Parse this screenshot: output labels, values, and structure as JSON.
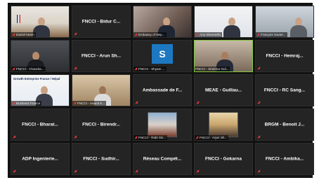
{
  "participants": [
    {
      "name": "Daniel Marin",
      "type": "video"
    },
    {
      "name": "FNCCI - Bidur C...",
      "type": "name"
    },
    {
      "name": "Embassy of Nep...",
      "type": "video"
    },
    {
      "name": "Ana Silvestello",
      "type": "video"
    },
    {
      "name": "François Xavier...",
      "type": "video"
    },
    {
      "name": "FNCCI - Chandra...",
      "type": "video"
    },
    {
      "name": "FNCCI - Arun Sh...",
      "type": "name"
    },
    {
      "name": "FNCCI - Shyam ...",
      "type": "avatar",
      "avatar_letter": "S"
    },
    {
      "name": "FNCCI - Shekhar Gol...",
      "type": "video"
    },
    {
      "name": "FNCCI - Hemraj...",
      "type": "name"
    },
    {
      "name": "Business France",
      "type": "video",
      "poster_text": "Growth Enterprise France / Népal"
    },
    {
      "name": "FNCCI - Anand K...",
      "type": "video"
    },
    {
      "name": "Ambassade de F...",
      "type": "name"
    },
    {
      "name": "MEAE - Guillau...",
      "type": "name"
    },
    {
      "name": "FNCCI - RC Sang...",
      "type": "name"
    },
    {
      "name": "FNCCI - Bharat...",
      "type": "name"
    },
    {
      "name": "FNCCI - Birendr...",
      "type": "name"
    },
    {
      "name": "FNCCI - Rabi Sin...",
      "type": "picture"
    },
    {
      "name": "FNCCI - Arjun Sh...",
      "type": "picture"
    },
    {
      "name": "BRGM - Benoit J...",
      "type": "name"
    },
    {
      "name": "ADP Ingenierie...",
      "type": "name"
    },
    {
      "name": "FNCCI - Sudhir...",
      "type": "name"
    },
    {
      "name": "Réseau Compét...",
      "type": "name"
    },
    {
      "name": "FNCCI - Gokarna",
      "type": "name"
    },
    {
      "name": "FNCCI - Ambika...",
      "type": "name"
    }
  ],
  "colors": {
    "background": "#121212",
    "tile": "#242424",
    "active_border": "#7ecb3a",
    "mute": "#e23a3a",
    "avatar": "#1d78c1"
  }
}
